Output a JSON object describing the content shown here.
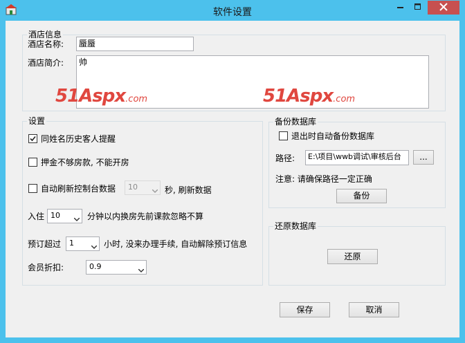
{
  "window": {
    "title": "软件设置",
    "icon": "app-window-icon",
    "controls": [
      "minimize-icon",
      "maximize-icon",
      "close-icon"
    ],
    "close_color": "#c75050",
    "titlebar_color": "#4cc1ec"
  },
  "hotel_info": {
    "group_title": "酒店信息",
    "name_label": "酒店名称:",
    "name_value": "蜃蜃",
    "intro_label": "酒店简介:",
    "intro_value": "帅",
    "watermark_1": "51Aspx",
    "watermark_1_suffix": ".com",
    "watermark_2": "51Aspx",
    "watermark_2_suffix": ".com"
  },
  "settings": {
    "group_title": "设置",
    "same_name_label": "同姓名历史客人提醒",
    "same_name_checked": true,
    "deposit_label": "押金不够房款, 不能开房",
    "deposit_checked": false,
    "auto_refresh_label": "自动刷新控制台数据",
    "auto_refresh_checked": false,
    "auto_refresh_value": "10",
    "auto_refresh_suffix": "秒, 刷新数据",
    "checkin_prefix": "入住",
    "checkin_value": "10",
    "checkin_suffix": "分钟以内换房先前课款忽略不算",
    "reserve_prefix": "预订超过",
    "reserve_value": "1",
    "reserve_suffix": "小时, 没来办理手续, 自动解除预订信息",
    "discount_label": "会员折扣:",
    "discount_value": "0.9"
  },
  "backup": {
    "group_title": "备份数据库",
    "auto_backup_label": "退出时自动备份数据库",
    "auto_backup_checked": false,
    "path_label": "路径:",
    "path_value": "E:\\项目\\wwb调试\\审核后台",
    "browse_label": "...",
    "note": "注意: 请确保路径一定正确",
    "backup_button": "备份"
  },
  "restore": {
    "group_title": "还原数据库",
    "restore_button": "还原"
  },
  "footer": {
    "save_button": "保存",
    "cancel_button": "取消"
  }
}
